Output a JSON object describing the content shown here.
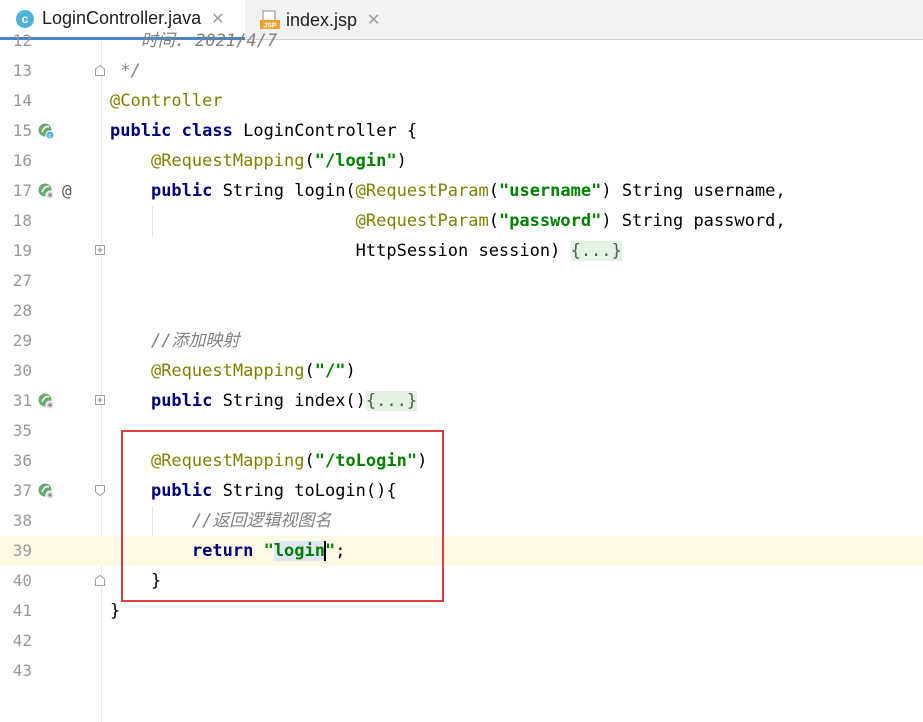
{
  "tabs": [
    {
      "label": "LoginController.java",
      "icon": "java-class-icon",
      "active": true
    },
    {
      "label": "index.jsp",
      "icon": "jsp-file-icon",
      "active": false
    }
  ],
  "lines": [
    {
      "n": "12",
      "text": "   时间: 2021/4/7"
    },
    {
      "n": "13",
      "text": " */"
    },
    {
      "n": "14",
      "text": "@Controller"
    },
    {
      "n": "15",
      "text": "public class LoginController {"
    },
    {
      "n": "16",
      "text": "    @RequestMapping(\"/login\")"
    },
    {
      "n": "17",
      "text": "    public String login(@RequestParam(\"username\") String username,"
    },
    {
      "n": "18",
      "text": "                        @RequestParam(\"password\") String password,"
    },
    {
      "n": "19",
      "text": "                        HttpSession session) {...}"
    },
    {
      "n": "27",
      "text": ""
    },
    {
      "n": "28",
      "text": ""
    },
    {
      "n": "29",
      "text": "    //添加映射"
    },
    {
      "n": "30",
      "text": "    @RequestMapping(\"/\")"
    },
    {
      "n": "31",
      "text": "    public String index(){...}"
    },
    {
      "n": "35",
      "text": ""
    },
    {
      "n": "36",
      "text": "    @RequestMapping(\"/toLogin\")"
    },
    {
      "n": "37",
      "text": "    public String toLogin(){"
    },
    {
      "n": "38",
      "text": "        //返回逻辑视图名"
    },
    {
      "n": "39",
      "text": "        return \"login\";"
    },
    {
      "n": "40",
      "text": "    }"
    },
    {
      "n": "41",
      "text": "}"
    },
    {
      "n": "42",
      "text": ""
    },
    {
      "n": "43",
      "text": ""
    }
  ],
  "code": {
    "l12": "   时间: 2021/4/7",
    "l13": " */",
    "annController": "@Controller",
    "kwPublic": "public",
    "kwClass": "class",
    "kwReturn": "return",
    "l15rest": " LoginController {",
    "annRequestMapping": "@RequestMapping",
    "annRequestParam": "@RequestParam",
    "strLogin": "\"/login\"",
    "strUsername": "\"username\"",
    "strPassword": "\"password\"",
    "strRoot": "\"/\"",
    "strToLogin": "\"/toLogin\"",
    "strQuote": "\"",
    "strLoginWord": "login",
    "l17mid": " String login(",
    "l17end": " String username,",
    "l18end": " String password,",
    "l19text": "HttpSession session) ",
    "foldDots": "{...}",
    "cmtAddMapping": "//添加映射",
    "cmtReturnView": "//返回逻辑视图名",
    "l31mid": " String index()",
    "l37mid": " String toLogin(){",
    "openParen": "(",
    "closeParen": ")",
    "semicolon": ";",
    "closeBrace": "}"
  },
  "gutter": {
    "at_symbol": "@"
  },
  "colors": {
    "keyword": "#000080",
    "annotation": "#808000",
    "string": "#008000",
    "comment": "#808080",
    "highlight_box": "#e03c3c",
    "current_line": "#fefae6"
  }
}
